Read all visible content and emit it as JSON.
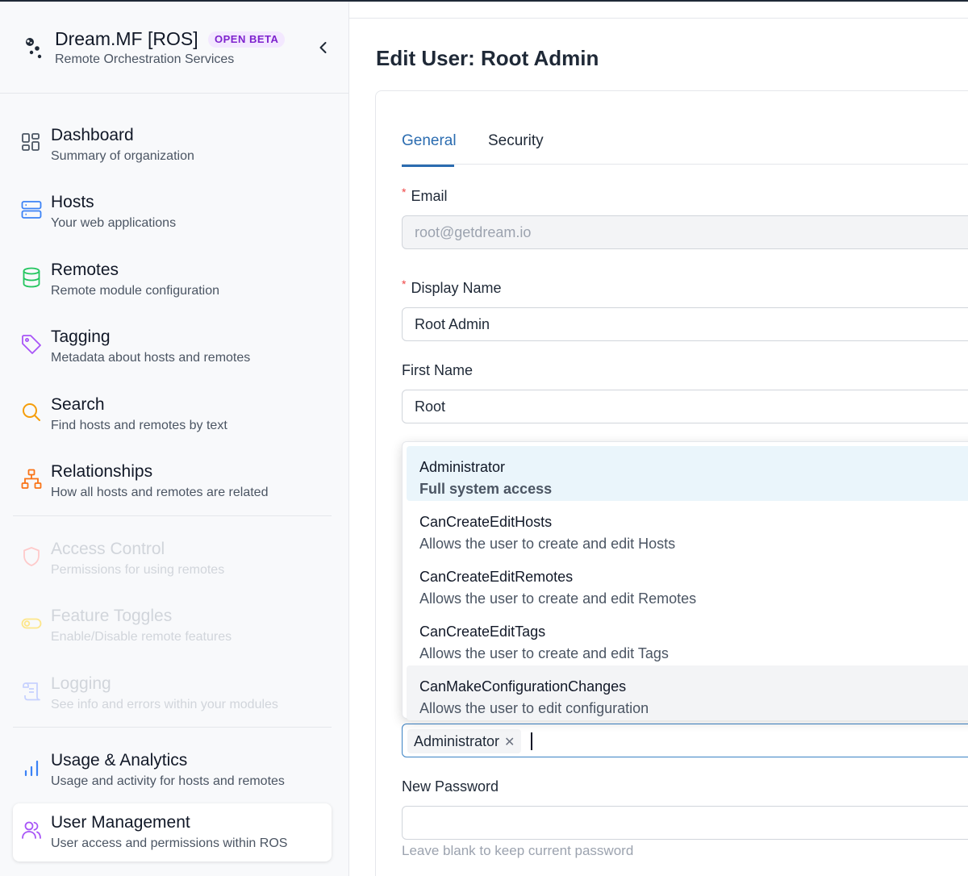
{
  "brand": {
    "title": "Dream.MF [ROS]",
    "badge": "OPEN BETA",
    "subtitle": "Remote Orchestration Services"
  },
  "nav": [
    {
      "label": "Dashboard",
      "desc": "Summary of organization",
      "icon": "dashboard-icon",
      "color": "#4b5563"
    },
    {
      "label": "Hosts",
      "desc": "Your web applications",
      "icon": "server-icon",
      "color": "#3b82f6"
    },
    {
      "label": "Remotes",
      "desc": "Remote module configuration",
      "icon": "database-icon",
      "color": "#22c55e"
    },
    {
      "label": "Tagging",
      "desc": "Metadata about hosts and remotes",
      "icon": "tag-icon",
      "color": "#a855f7"
    },
    {
      "label": "Search",
      "desc": "Find hosts and remotes by text",
      "icon": "search-icon",
      "color": "#f59e0b"
    },
    {
      "label": "Relationships",
      "desc": "How all hosts and remotes are related",
      "icon": "hierarchy-icon",
      "color": "#f97316"
    },
    {
      "label": "Access Control",
      "desc": "Permissions for using remotes",
      "icon": "shield-icon",
      "color": "#fecaca"
    },
    {
      "label": "Feature Toggles",
      "desc": "Enable/Disable remote features",
      "icon": "toggle-icon",
      "color": "#fde68a"
    },
    {
      "label": "Logging",
      "desc": "See info and errors within your modules",
      "icon": "scroll-icon",
      "color": "#c7d2fe"
    },
    {
      "label": "Usage & Analytics",
      "desc": "Usage and activity for hosts and remotes",
      "icon": "bar-chart-icon",
      "color": "#3b82f6"
    },
    {
      "label": "User Management",
      "desc": "User access and permissions within ROS",
      "icon": "users-icon",
      "color": "#a855f7"
    }
  ],
  "page": {
    "title": "Edit User: Root Admin",
    "tabs": [
      "General",
      "Security"
    ],
    "active_tab": "General"
  },
  "form": {
    "email_label": "Email",
    "email_value": "root@getdream.io",
    "display_name_label": "Display Name",
    "display_name_value": "Root Admin",
    "first_name_label": "First Name",
    "first_name_value": "Root",
    "roles_selected": [
      "Administrator"
    ],
    "new_password_label": "New Password",
    "new_password_value": "",
    "new_password_help": "Leave blank to keep current password"
  },
  "dropdown": {
    "options": [
      {
        "title": "Administrator",
        "desc": "Full system access"
      },
      {
        "title": "CanCreateEditHosts",
        "desc": "Allows the user to create and edit Hosts"
      },
      {
        "title": "CanCreateEditRemotes",
        "desc": "Allows the user to create and edit Remotes"
      },
      {
        "title": "CanCreateEditTags",
        "desc": "Allows the user to create and edit Tags"
      },
      {
        "title": "CanMakeConfigurationChanges",
        "desc": "Allows the user to edit configuration"
      }
    ]
  },
  "colors": {
    "accent": "#2b6cb0",
    "required": "#ef4444",
    "badge_bg": "#f3e8ff",
    "badge_text": "#7e22ce"
  }
}
